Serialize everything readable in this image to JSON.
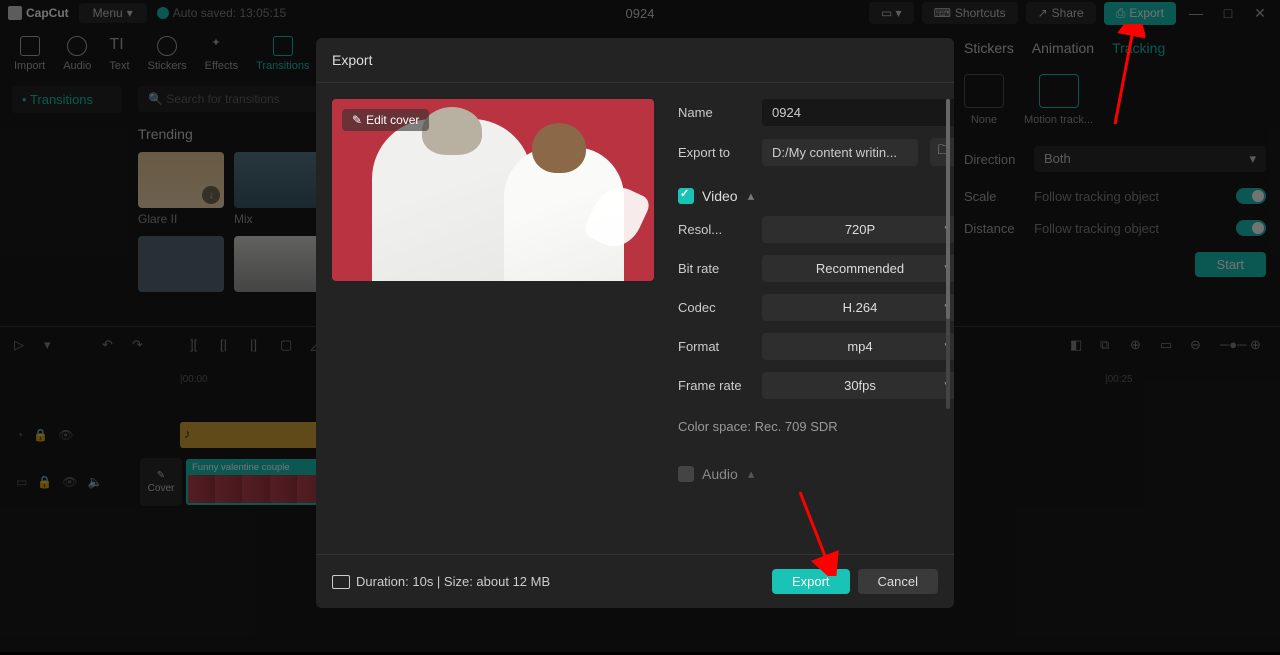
{
  "top": {
    "app": "CapCut",
    "menu": "Menu",
    "autosave": "Auto saved: 13:05:15",
    "project": "0924",
    "shortcuts": "Shortcuts",
    "share": "Share",
    "export": "Export"
  },
  "media_tabs": [
    "Import",
    "Audio",
    "Text",
    "Stickers",
    "Effects",
    "Transitions"
  ],
  "sidebar": {
    "transitions": "Transitions"
  },
  "search": {
    "placeholder": "Search for transitions"
  },
  "library": {
    "heading": "Trending",
    "items": [
      {
        "label": "Glare II"
      },
      {
        "label": "Mix"
      }
    ]
  },
  "right": {
    "tabs": {
      "stickers": "Stickers",
      "animation": "Animation",
      "tracking": "Tracking"
    },
    "track_opts": {
      "none": "None",
      "motion": "Motion track..."
    },
    "direction_label": "Direction",
    "direction_value": "Both",
    "scale_label": "Scale",
    "scale_value": "Follow tracking object",
    "distance_label": "Distance",
    "distance_value": "Follow tracking object",
    "start": "Start"
  },
  "timeline": {
    "ticks": {
      "t0": "|00:00",
      "t1": "|00:25"
    },
    "cover": "Cover",
    "clip_title": "Funny valentine couple"
  },
  "dialog": {
    "title": "Export",
    "edit_cover": "Edit cover",
    "name_label": "Name",
    "name_value": "0924",
    "export_to_label": "Export to",
    "export_to_value": "D:/My content writin...",
    "video_section": "Video",
    "resolution_label": "Resol...",
    "resolution_value": "720P",
    "bitrate_label": "Bit rate",
    "bitrate_value": "Recommended",
    "codec_label": "Codec",
    "codec_value": "H.264",
    "format_label": "Format",
    "format_value": "mp4",
    "framerate_label": "Frame rate",
    "framerate_value": "30fps",
    "color_space": "Color space: Rec. 709 SDR",
    "audio_section": "Audio",
    "duration": "Duration: 10s | Size: about 12 MB",
    "export_btn": "Export",
    "cancel_btn": "Cancel"
  }
}
